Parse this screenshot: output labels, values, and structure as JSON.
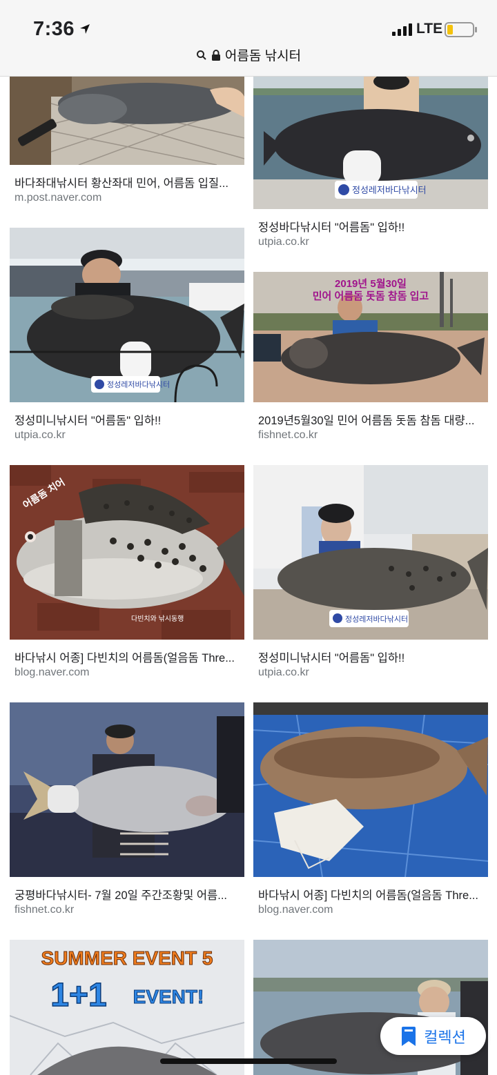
{
  "status": {
    "time": "7:36",
    "carrier": "LTE"
  },
  "browser": {
    "url_text": "어름돔 낚시터"
  },
  "results": [
    {
      "title": "바다좌대낚시터 황산좌대 민어, 어름돔 입질...",
      "domain": "m.post.naver.com",
      "image": "fish-on-net"
    },
    {
      "title": "정성바다낚시터 \"어름돔\" 입하!!",
      "domain": "utpia.co.kr",
      "image": "woman-holding-black-fish",
      "watermark": "정성레저바다낚시터"
    },
    {
      "title": "정성미니낚시터 \"어름돔\" 입하!!",
      "domain": "utpia.co.kr",
      "image": "man-holding-black-fish",
      "watermark": "정성레저바다낚시터"
    },
    {
      "title": "2019년5월30일 민어 어름돔 돗돔 참돔 대량...",
      "domain": "fishnet.co.kr",
      "image": "man-holding-big-fish",
      "overlay_line1": "2019년 5월30일",
      "overlay_line2": "민어 어름돔 돗돔 참돔 입고"
    },
    {
      "title": "바다낚시 어종] 다빈치의 어름돔(얼음돔 Thre...",
      "domain": "blog.naver.com",
      "image": "spotted-fish-closeup",
      "overlay_line1": "어름돔 치어",
      "overlay_line2": "다빈치와 낚시동행"
    },
    {
      "title": "정성미니낚시터 \"어름돔\" 입하!!",
      "domain": "utpia.co.kr",
      "image": "woman-with-spotted-fish",
      "watermark": "정성레저바다낚시터"
    },
    {
      "title": "궁평바다낚시터- 7월 20일 주간조황및 어름...",
      "domain": "fishnet.co.kr",
      "image": "man-holding-silver-fish"
    },
    {
      "title": "바다낚시 어종] 다빈치의 어름돔(얼음돔 Thre...",
      "domain": "blog.naver.com",
      "image": "fish-on-blue-tarp"
    },
    {
      "title": "",
      "domain": "",
      "image": "summer-event-banner",
      "overlay_line1": "SUMMER EVENT 5",
      "overlay_line2": "1+1",
      "overlay_line3": "EVENT!"
    },
    {
      "title": "",
      "domain": "",
      "image": "woman-with-fish-pier"
    }
  ],
  "collections_button": {
    "label": "컬렉션",
    "icon": "bookmark-icon"
  },
  "colors": {
    "link_blue": "#1a73e8",
    "domain_gray": "#70757a"
  }
}
